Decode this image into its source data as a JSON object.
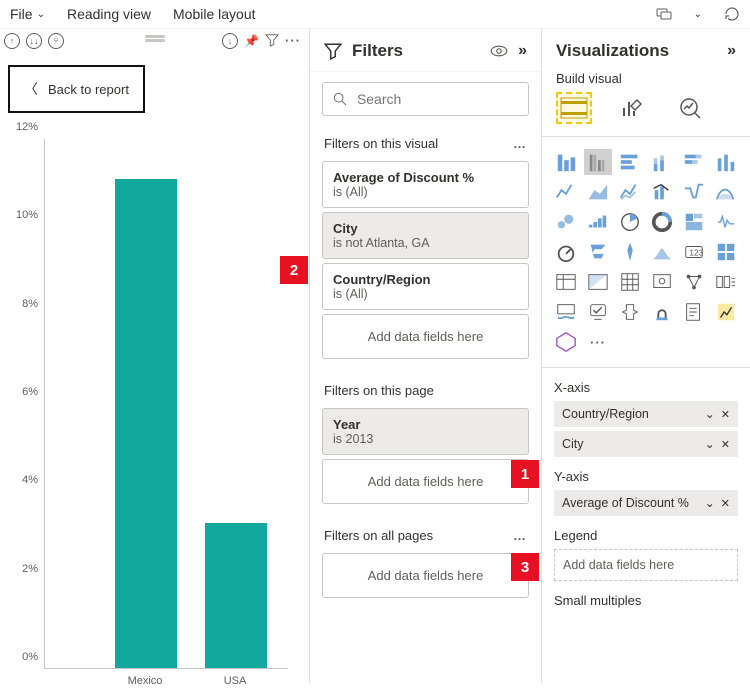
{
  "topbar": {
    "file": "File",
    "reading": "Reading view",
    "mobile": "Mobile layout"
  },
  "back_label": "Back to report",
  "chart_data": {
    "type": "bar",
    "categories": [
      "Mexico",
      "USA"
    ],
    "values": [
      11.1,
      3.3
    ],
    "ymin": 0,
    "ymax": 12,
    "y_ticks": [
      0,
      2,
      4,
      6,
      8,
      10,
      12
    ],
    "y_unit": "%"
  },
  "filters": {
    "title": "Filters",
    "search_placeholder": "Search",
    "visual_label": "Filters on this visual",
    "visual_items": [
      {
        "name": "Average of Discount %",
        "value": "is (All)",
        "selected": false
      },
      {
        "name": "City",
        "value": "is not Atlanta, GA",
        "selected": true
      },
      {
        "name": "Country/Region",
        "value": "is (All)",
        "selected": false
      }
    ],
    "page_label": "Filters on this page",
    "page_items": [
      {
        "name": "Year",
        "value": "is 2013",
        "selected": true
      }
    ],
    "all_label": "Filters on all pages",
    "add_placeholder": "Add data fields here"
  },
  "viz": {
    "title": "Visualizations",
    "build_label": "Build visual",
    "x_axis": {
      "title": "X-axis",
      "fields": [
        "Country/Region",
        "City"
      ]
    },
    "y_axis": {
      "title": "Y-axis",
      "fields": [
        "Average of Discount %"
      ]
    },
    "legend": {
      "title": "Legend",
      "placeholder": "Add data fields here"
    },
    "small_mult": "Small multiples"
  },
  "callouts": {
    "c1": "1",
    "c2": "2",
    "c3": "3"
  }
}
